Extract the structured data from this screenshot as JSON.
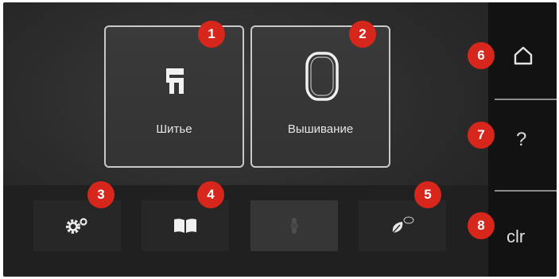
{
  "modes": {
    "sewing_label": "Шитье",
    "embroidery_label": "Вышивание"
  },
  "sidebar": {
    "home_icon": "home-icon",
    "help_label": "?",
    "clr_label": "clr"
  },
  "bottom": {
    "icons": [
      "gears-icon",
      "open-book-icon",
      "bobbin-icon-disabled",
      "eco-leaf-icon"
    ]
  },
  "callouts": [
    "1",
    "2",
    "3",
    "4",
    "5",
    "6",
    "7",
    "8"
  ],
  "colors": {
    "callout": "#d7261c",
    "tile_border": "#c9c9c9",
    "background": "#2b2b2b"
  }
}
